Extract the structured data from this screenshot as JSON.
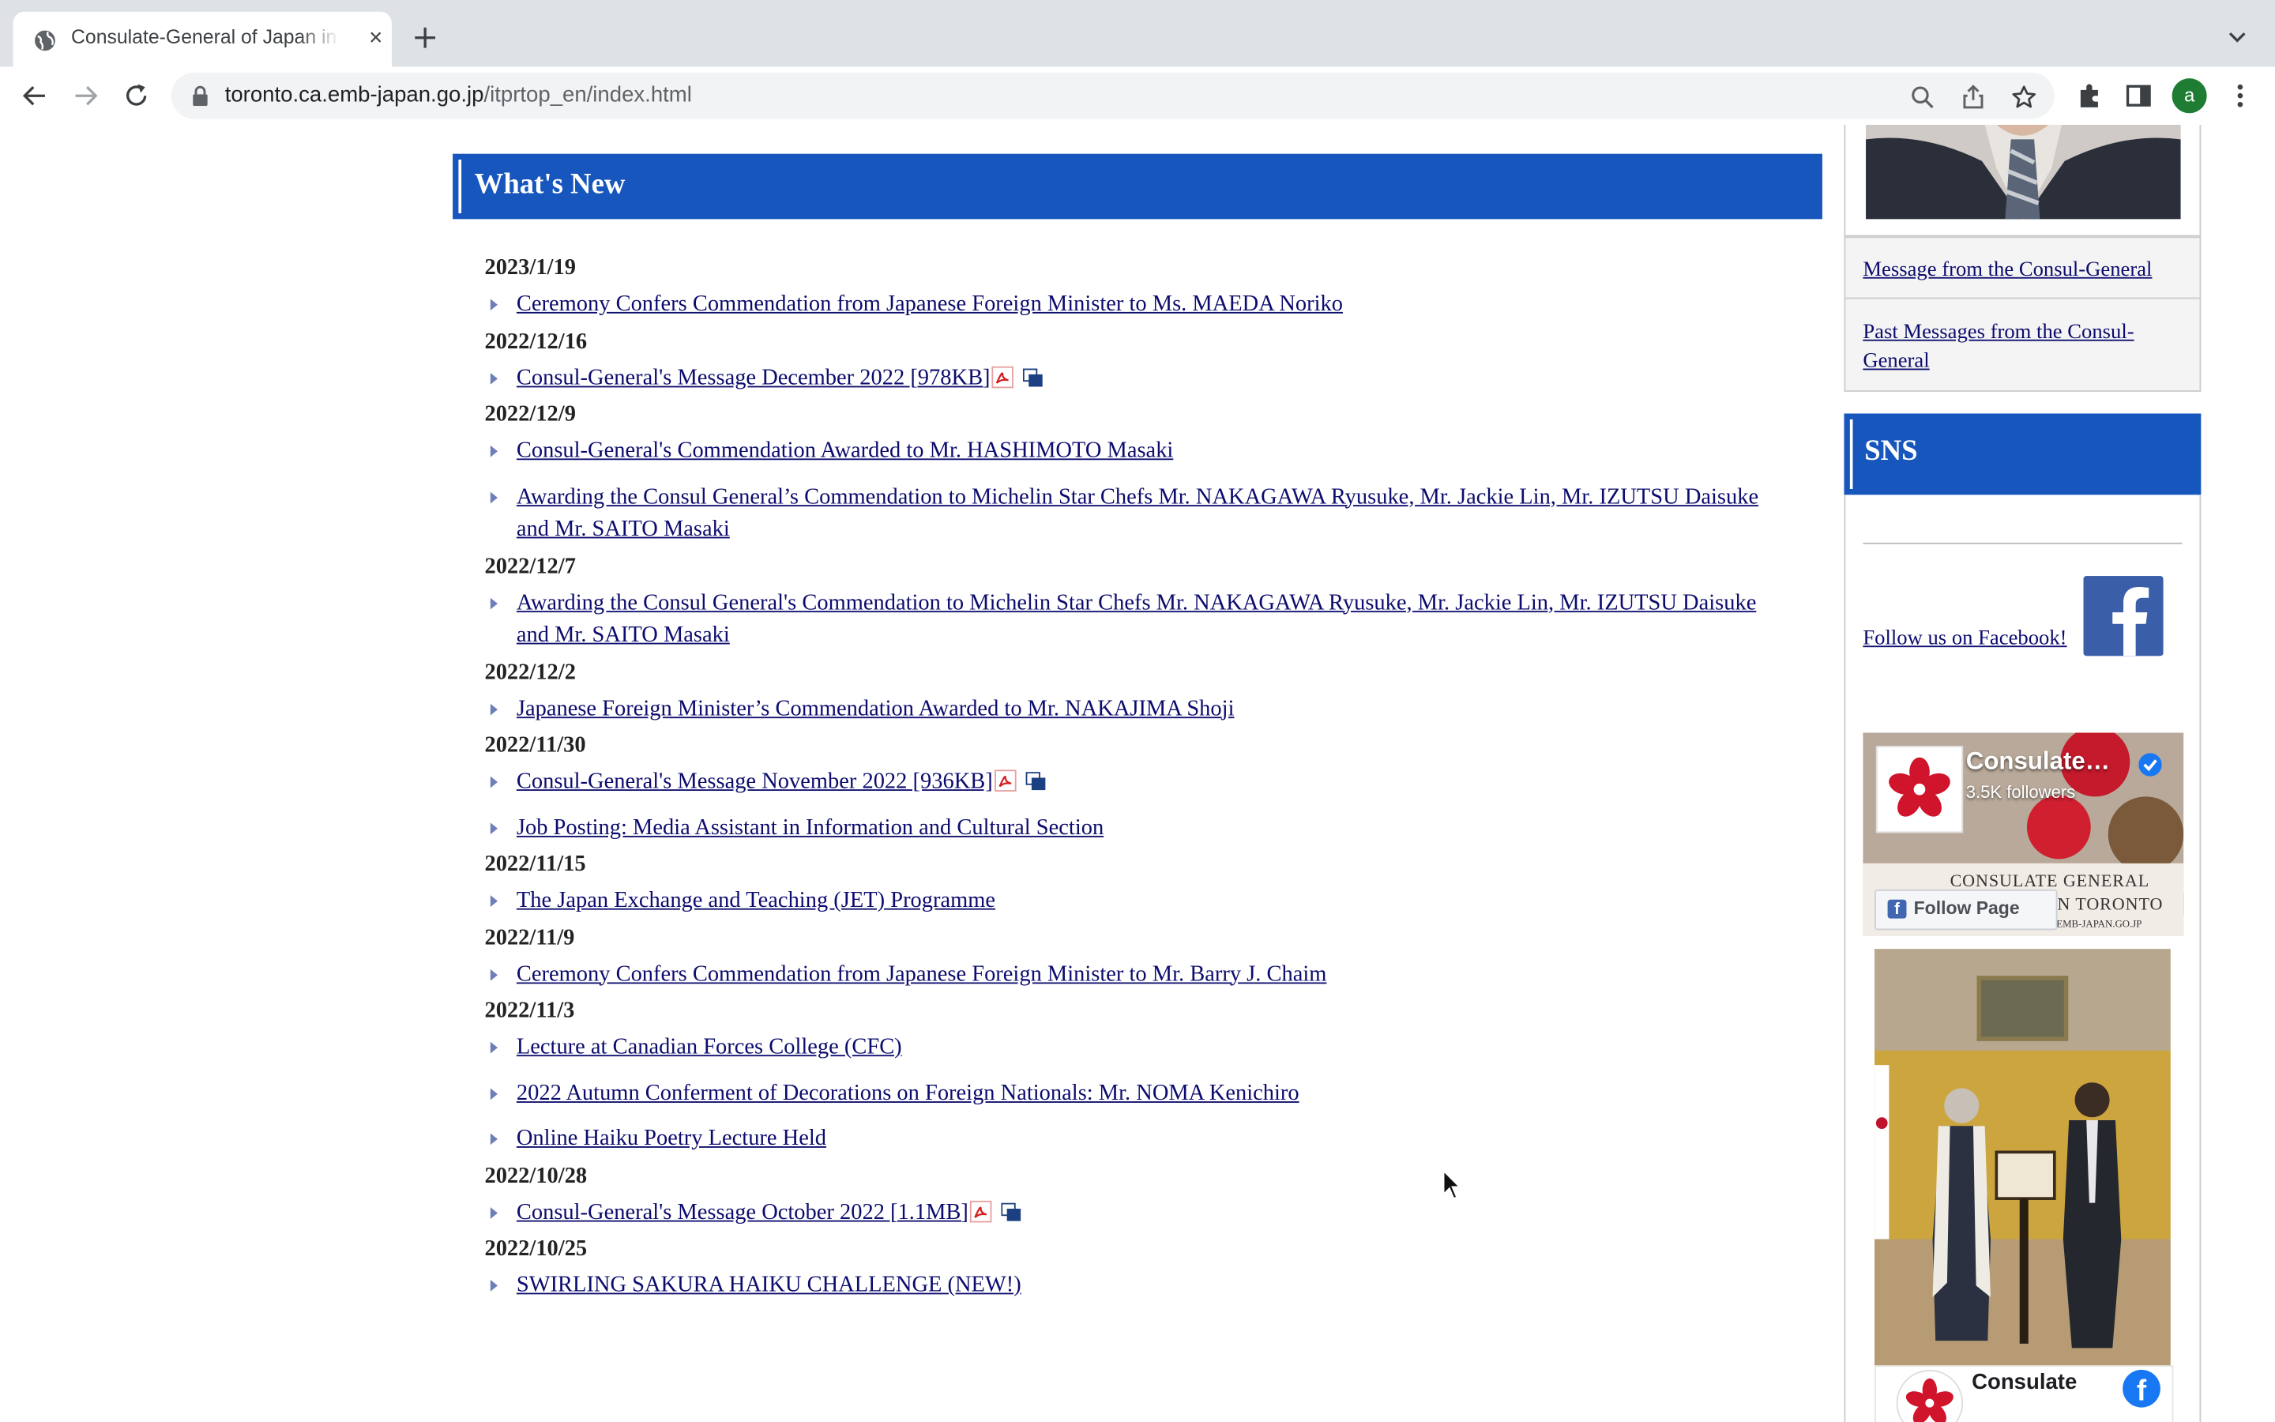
{
  "browser": {
    "tab_title": "Consulate-General of Japan in Toronto",
    "tab_close": "×",
    "url_host": "toronto.ca.emb-japan.go.jp",
    "url_path": "/itprtop_en/index.html",
    "profile_initial": "a"
  },
  "whats_new": {
    "title": "What's New",
    "groups": [
      {
        "date": "2023/1/19",
        "items": [
          {
            "label": "Ceremony Confers Commendation from Japanese Foreign Minister to Ms. MAEDA Noriko"
          }
        ]
      },
      {
        "date": "2022/12/16",
        "items": [
          {
            "label": "Consul-General's Message December 2022 [978KB]",
            "pdf": true
          }
        ]
      },
      {
        "date": "2022/12/9",
        "items": [
          {
            "label": "Consul-General's Commendation Awarded to Mr. HASHIMOTO Masaki"
          },
          {
            "label": "Awarding the Consul General’s Commendation to Michelin Star Chefs Mr. NAKAGAWA Ryusuke, Mr. Jackie Lin, Mr. IZUTSU Daisuke and Mr. SAITO Masaki"
          }
        ]
      },
      {
        "date": "2022/12/7",
        "items": [
          {
            "label": "Awarding the Consul General's Commendation to Michelin Star Chefs Mr. NAKAGAWA Ryusuke, Mr. Jackie Lin, Mr. IZUTSU Daisuke and Mr. SAITO Masaki"
          }
        ]
      },
      {
        "date": "2022/12/2",
        "items": [
          {
            "label": "Japanese Foreign Minister’s Commendation Awarded to Mr. NAKAJIMA Shoji"
          }
        ]
      },
      {
        "date": "2022/11/30",
        "items": [
          {
            "label": "Consul-General's Message November 2022 [936KB]",
            "pdf": true
          },
          {
            "label": "Job Posting: Media Assistant in Information and Cultural Section"
          }
        ]
      },
      {
        "date": "2022/11/15",
        "items": [
          {
            "label": "The Japan Exchange and Teaching (JET) Programme"
          }
        ]
      },
      {
        "date": "2022/11/9",
        "items": [
          {
            "label": "Ceremony Confers Commendation from Japanese Foreign Minister to Mr. Barry J. Chaim"
          }
        ]
      },
      {
        "date": "2022/11/3",
        "items": [
          {
            "label": "Lecture at Canadian Forces College (CFC)"
          },
          {
            "label": "2022 Autumn Conferment of Decorations on Foreign Nationals: Mr. NOMA Kenichiro"
          },
          {
            "label": "Online Haiku Poetry Lecture Held"
          }
        ]
      },
      {
        "date": "2022/10/28",
        "items": [
          {
            "label": "Consul-General's Message October 2022 [1.1MB]",
            "pdf": true
          }
        ]
      },
      {
        "date": "2022/10/25",
        "items": [
          {
            "label": "SWIRLING SAKURA HAIKU CHALLENGE (NEW!)"
          }
        ]
      }
    ]
  },
  "sidebar": {
    "message_link": "Message from the Consul-General",
    "past_messages_link": "Past Messages from the Consul-General",
    "sns_title": "SNS",
    "facebook_link": "Follow us on Facebook!",
    "fb_widget": {
      "page_name": "Consulate…",
      "followers": "3.5K followers",
      "follow_button": "Follow Page",
      "banner_line1": "CONSULATE GENERAL",
      "banner_line2": "N TORONTO",
      "banner_line3": "WWW.TORONTO.CA.EMB-JAPAN.GO.JP",
      "post_author": "Consulate"
    }
  },
  "colors": {
    "header_blue": "#1656bd",
    "link": "#0c0c6e"
  }
}
